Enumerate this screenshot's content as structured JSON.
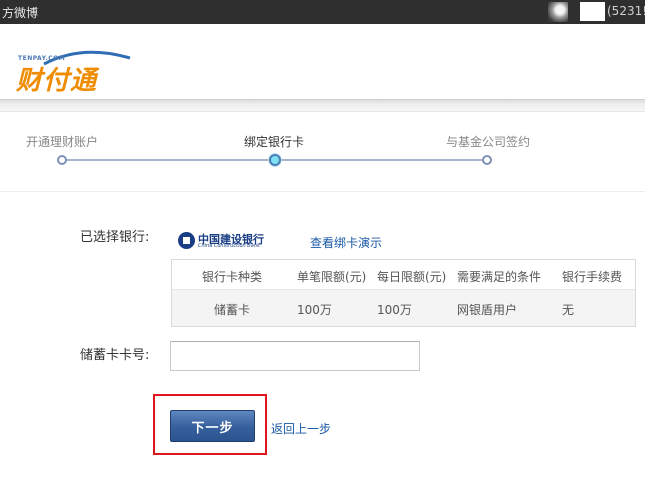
{
  "topbar": {
    "app_title": "方微博",
    "user_id": "(5231!"
  },
  "logo": {
    "small_text": "TENPAY.COM",
    "main_text": "财付通"
  },
  "steps": [
    {
      "label": "开通理财账户",
      "active": false
    },
    {
      "label": "绑定银行卡",
      "active": true
    },
    {
      "label": "与基金公司签约",
      "active": false
    }
  ],
  "bank": {
    "label": "已选择银行:",
    "logo_name_cn": "中国建设银行",
    "logo_name_en": "China Construction Bank",
    "demo_link": "查看绑卡演示"
  },
  "limits_table": {
    "headers": [
      "银行卡种类",
      "单笔限额(元)",
      "每日限额(元)",
      "需要满足的条件",
      "银行手续费"
    ],
    "rows": [
      [
        "储蓄卡",
        "100万",
        "100万",
        "网银盾用户",
        "无"
      ]
    ]
  },
  "card": {
    "label": "储蓄卡卡号:",
    "value": "",
    "placeholder": ""
  },
  "actions": {
    "next_label": "下一步",
    "back_label": "返回上一步"
  },
  "colors": {
    "accent_orange": "#f08c00",
    "button_blue": "#355f9c",
    "link_blue": "#1a5aa6",
    "highlight_red": "#e0161e"
  }
}
